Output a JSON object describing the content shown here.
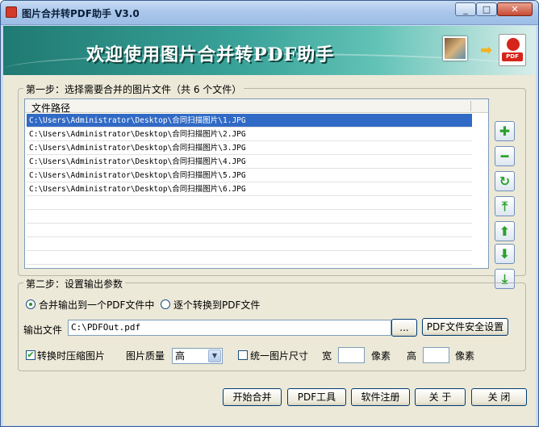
{
  "window": {
    "title": "图片合并转PDF助手 V3.0",
    "minimize": "_",
    "maximize": "□",
    "close": "✕"
  },
  "banner": {
    "welcome": "欢迎使用图片合并转PDF助手",
    "pdf_badge": "PDF",
    "arrow": "➡"
  },
  "step1": {
    "legend": "第一步：选择需要合并的图片文件（共 6 个文件）",
    "column_header": "文件路径",
    "files": [
      "C:\\Users\\Administrator\\Desktop\\合同扫描图片\\1.JPG",
      "C:\\Users\\Administrator\\Desktop\\合同扫描图片\\2.JPG",
      "C:\\Users\\Administrator\\Desktop\\合同扫描图片\\3.JPG",
      "C:\\Users\\Administrator\\Desktop\\合同扫描图片\\4.JPG",
      "C:\\Users\\Administrator\\Desktop\\合同扫描图片\\5.JPG",
      "C:\\Users\\Administrator\\Desktop\\合同扫描图片\\6.JPG"
    ],
    "selected_index": 0,
    "side_buttons": [
      {
        "name": "add-icon",
        "glyph": "✚"
      },
      {
        "name": "remove-icon",
        "glyph": "━"
      },
      {
        "name": "refresh-icon",
        "glyph": "↻"
      },
      {
        "name": "move-top-icon",
        "glyph": "⤒"
      },
      {
        "name": "move-up-icon",
        "glyph": "⬆"
      },
      {
        "name": "move-down-icon",
        "glyph": "⬇"
      },
      {
        "name": "move-bottom-icon",
        "glyph": "⤓"
      }
    ]
  },
  "step2": {
    "legend": "第二步：设置输出参数",
    "radio_merge": "合并输出到一个PDF文件中",
    "radio_each": "逐个转换到PDF文件",
    "output_label": "输出文件",
    "output_value": "C:\\PDFOut.pdf",
    "browse": "...",
    "security": "PDF文件安全设置",
    "compress_label": "转换时压缩图片",
    "compress_checked": "✔",
    "quality_label": "图片质量",
    "quality_value": "高",
    "unify_label": "统一图片尺寸",
    "width_label": "宽",
    "width_unit": "像素",
    "height_label": "高",
    "height_unit": "像素"
  },
  "footer": {
    "start": "开始合并",
    "pdf_tools": "PDF工具",
    "register": "软件注册",
    "about": "关 于",
    "close": "关 闭"
  },
  "colors": {
    "selection": "#316ac5",
    "accent_green": "#2aa12a",
    "banner": "#3aa39a"
  }
}
